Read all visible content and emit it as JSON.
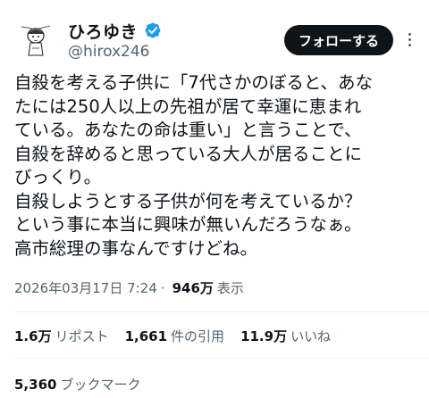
{
  "user": {
    "display_name": "ひろゆき",
    "handle": "@hirox246",
    "verified": true,
    "verified_color": "#1d9bf0"
  },
  "actions": {
    "follow_label": "フォローする"
  },
  "tweet": {
    "lines": [
      "自殺を考える子供に「7代さかのぼると、あな",
      "たには250人以上の先祖が居て幸運に恵まれ",
      "ている。あなたの命は重い」と言うことで、",
      "自殺を辞めると思っている大人が居ることに",
      "びっくり。",
      "自殺しようとする子供が何を考えているか？",
      "という事に本当に興味が無いんだろうなぁ。",
      "高市総理の事なんですけどね。"
    ]
  },
  "meta": {
    "timestamp": "2026年03月17日 7:24",
    "separator": "·",
    "views_count": "946万",
    "views_label": "表示"
  },
  "stats": [
    {
      "count": "1.6万",
      "label": "リポスト"
    },
    {
      "count": "1,661",
      "label": "件の引用"
    },
    {
      "count": "11.9万",
      "label": "いいね"
    }
  ],
  "bookmarks": {
    "count": "5,360",
    "label": "ブックマーク"
  },
  "icons": {
    "avatar": "avatar-drawing",
    "verified": "verified-badge-icon",
    "more": "more-vertical-icon"
  }
}
